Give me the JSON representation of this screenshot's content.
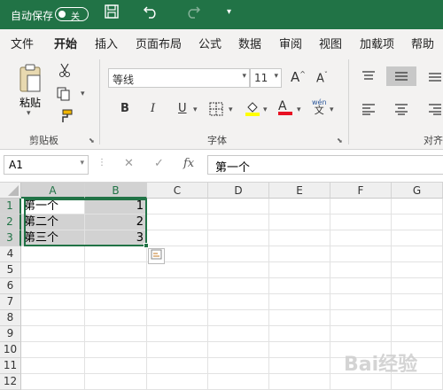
{
  "titlebar": {
    "autosave_label": "自动保存",
    "toggle_state": "关",
    "save_icon": "save-icon",
    "undo_icon": "undo-icon",
    "redo_icon": "redo-icon",
    "customize_icon": "dropdown-icon"
  },
  "menu": {
    "items": [
      "文件",
      "开始",
      "插入",
      "页面布局",
      "公式",
      "数据",
      "审阅",
      "视图",
      "加载项",
      "帮助"
    ],
    "active": "开始"
  },
  "ribbon": {
    "clipboard": {
      "paste_label": "粘贴",
      "group_label": "剪贴板"
    },
    "font": {
      "font_name": "等线",
      "font_size": "11",
      "bold": "B",
      "italic": "I",
      "underline": "U",
      "group_label": "字体",
      "grow_label": "A",
      "shrink_label": "A",
      "color_label": "A",
      "phonetic_top": "wén",
      "phonetic_bottom": "文",
      "highlight_color": "#ffff00",
      "font_color": "#e81123"
    },
    "alignment": {
      "group_label": "对齐"
    }
  },
  "formula_bar": {
    "name_box": "A1",
    "cancel_icon": "cancel-icon",
    "enter_icon": "check-icon",
    "fx_label": "fx",
    "content": "第一个"
  },
  "grid": {
    "columns": [
      "A",
      "B",
      "C",
      "D",
      "E",
      "F",
      "G"
    ],
    "rows": [
      "1",
      "2",
      "3",
      "4",
      "5",
      "6",
      "7",
      "8",
      "9",
      "10",
      "11",
      "12"
    ],
    "cells": [
      [
        "第一个",
        "1"
      ],
      [
        "第二个",
        "2"
      ],
      [
        "第三个",
        "3"
      ]
    ],
    "selection_color": "#217346"
  },
  "watermark": "Bai经验"
}
